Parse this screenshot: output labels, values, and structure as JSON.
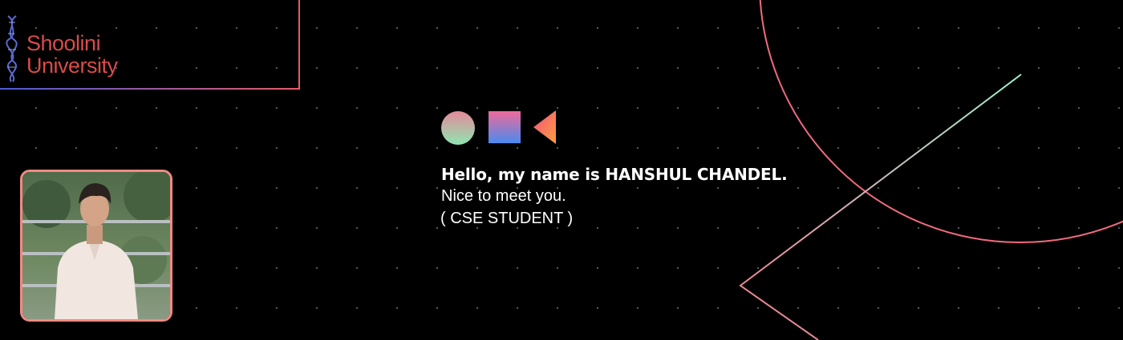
{
  "brand": {
    "line1": "Shoolini",
    "line2": "University",
    "color": "#d94b4b"
  },
  "profile": {
    "photo_border_color": "#f08a82"
  },
  "intro": {
    "greeting": "Hello, my name is HANSHUL CHANDEL.",
    "subtitle": "Nice to meet you.",
    "role": "( CSE STUDENT )"
  },
  "icons": [
    "circle-icon",
    "square-icon",
    "triangle-icon"
  ],
  "colors": {
    "background": "#000000",
    "accent_pink": "#f06a8a",
    "accent_mint": "#8ee6c0",
    "accent_blue": "#4a7cf0",
    "accent_orange": "#ff8a3a"
  }
}
